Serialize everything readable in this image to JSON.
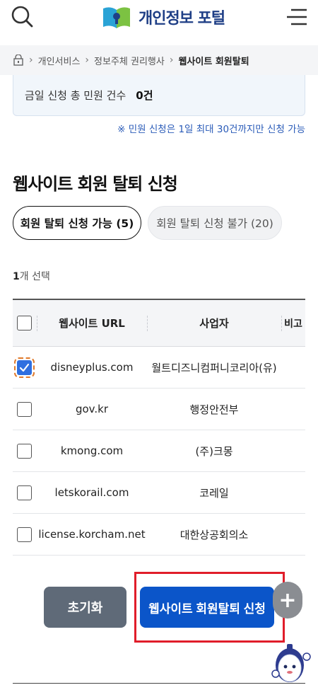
{
  "header": {
    "logo_text": "개인정보 포털",
    "search_icon": "search-icon",
    "menu_icon": "hamburger-menu-icon"
  },
  "breadcrumb": {
    "home_icon": "home-icon",
    "items": [
      "개인서비스",
      "정보주체 권리행사",
      "웹사이트 회원탈퇴"
    ]
  },
  "daily_count": {
    "label": "금일 신청 총 민원 건수",
    "value": "0건"
  },
  "notice": "※ 민원 신청은 1일 최대 30건까지만 신청 가능",
  "page_title": "웹사이트 회원 탈퇴 신청",
  "tabs": [
    {
      "label": "회원 탈퇴 신청 가능 (5)",
      "active": true
    },
    {
      "label": "회원 탈퇴 신청 불가 (20)",
      "active": false
    }
  ],
  "selected": {
    "count": "1",
    "suffix": "개 선택"
  },
  "table": {
    "headers": {
      "url": "웹사이트 URL",
      "business": "사업자",
      "note": "비고"
    },
    "rows": [
      {
        "url": "disneyplus.com",
        "business": "월트디즈니컴퍼니코리아(유)",
        "checked": true
      },
      {
        "url": "gov.kr",
        "business": "행정안전부",
        "checked": false
      },
      {
        "url": "kmong.com",
        "business": "(주)크몽",
        "checked": false
      },
      {
        "url": "letskorail.com",
        "business": "코레일",
        "checked": false
      },
      {
        "url": "license.korcham.net",
        "business": "대한상공회의소",
        "checked": false
      }
    ]
  },
  "buttons": {
    "reset": "초기화",
    "submit": "웹사이트 회원탈퇴 신청",
    "plus": "+"
  },
  "colors": {
    "primary": "#0b55c9",
    "reset_bg": "#5f6a78",
    "highlight": "#e01d2a",
    "logo_text": "#1f3f86"
  }
}
